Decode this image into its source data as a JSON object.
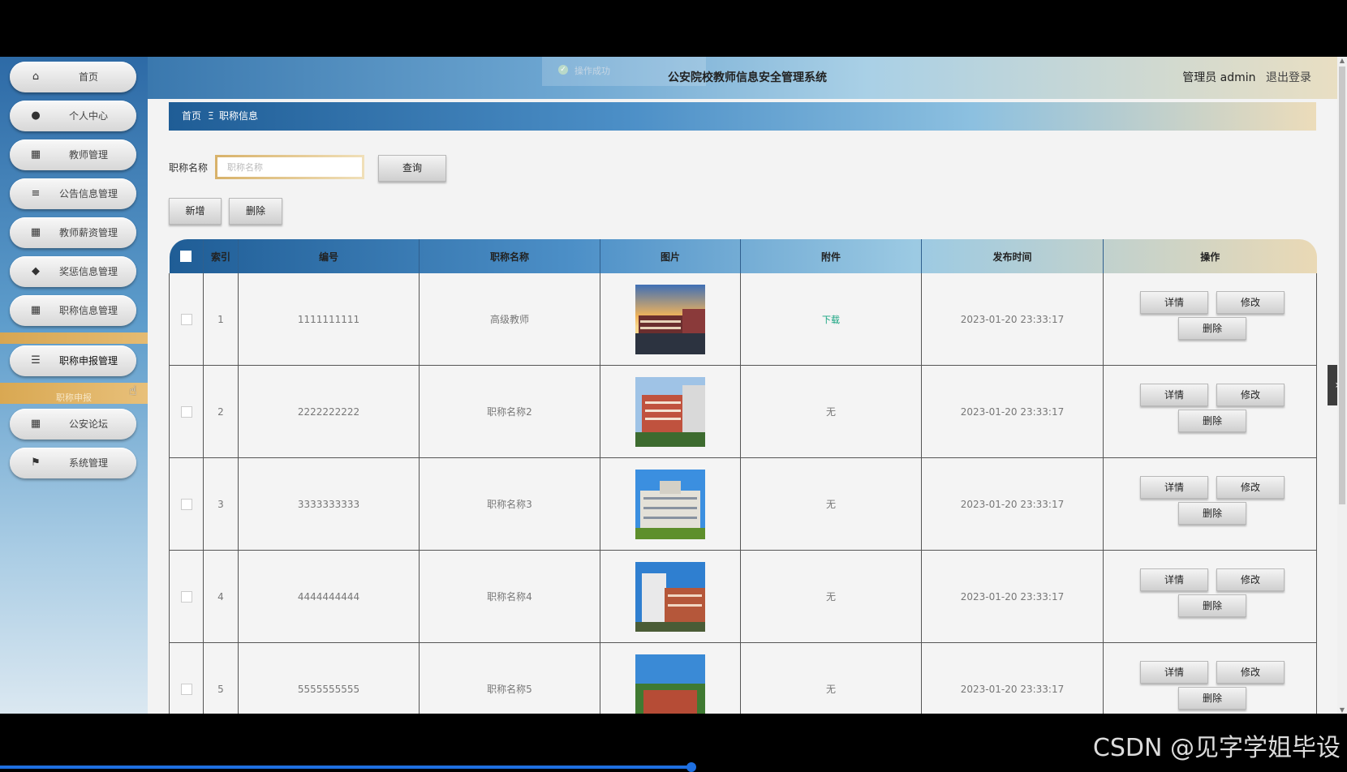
{
  "header": {
    "title": "公安院校教师信息安全管理系统",
    "user": "管理员 admin",
    "logout": "退出登录",
    "toast": "操作成功"
  },
  "sidebar": {
    "items": [
      {
        "label": "首页",
        "icon": "home-icon",
        "glyph": "⌂"
      },
      {
        "label": "个人中心",
        "icon": "user-icon",
        "glyph": "●"
      },
      {
        "label": "教师管理",
        "icon": "grid-icon",
        "glyph": "▦"
      },
      {
        "label": "公告信息管理",
        "icon": "list-icon",
        "glyph": "≡"
      },
      {
        "label": "教师薪资管理",
        "icon": "grid-icon",
        "glyph": "▦"
      },
      {
        "label": "奖惩信息管理",
        "icon": "pin-icon",
        "glyph": "◆"
      },
      {
        "label": "职称信息管理",
        "icon": "grid-icon",
        "glyph": "▦"
      },
      {
        "label": "职称申报管理",
        "icon": "sliders-icon",
        "glyph": "☰"
      },
      {
        "label": "公安论坛",
        "icon": "grid-icon",
        "glyph": "▦"
      },
      {
        "label": "系统管理",
        "icon": "flag-icon",
        "glyph": "⚑"
      }
    ],
    "sub_item": "职称申报"
  },
  "breadcrumb": {
    "home": "首页",
    "sep": "Ξ",
    "current": "职称信息"
  },
  "search": {
    "label": "职称名称",
    "placeholder": "职称名称",
    "value": "",
    "query_button": "查询"
  },
  "actions": {
    "add": "新增",
    "delete": "删除"
  },
  "table": {
    "columns": [
      "索引",
      "编号",
      "职称名称",
      "图片",
      "附件",
      "发布时间",
      "操作"
    ],
    "rows": [
      {
        "index": "1",
        "code": "1111111111",
        "title": "高级教师",
        "attachment": "下载",
        "time": "2023-01-20 23:33:17"
      },
      {
        "index": "2",
        "code": "2222222222",
        "title": "职称名称2",
        "attachment": "无",
        "time": "2023-01-20 23:33:17"
      },
      {
        "index": "3",
        "code": "3333333333",
        "title": "职称名称3",
        "attachment": "无",
        "time": "2023-01-20 23:33:17"
      },
      {
        "index": "4",
        "code": "4444444444",
        "title": "职称名称4",
        "attachment": "无",
        "time": "2023-01-20 23:33:17"
      },
      {
        "index": "5",
        "code": "5555555555",
        "title": "职称名称5",
        "attachment": "无",
        "time": "2023-01-20 23:33:17"
      }
    ],
    "ops": {
      "detail": "详情",
      "edit": "修改",
      "delete": "删除"
    }
  },
  "watermark": "CSDN @见字学姐毕设",
  "colors": {
    "accent_blue": "#2d6aa6",
    "accent_gold": "#d7a652",
    "download_green": "#14a37f"
  }
}
